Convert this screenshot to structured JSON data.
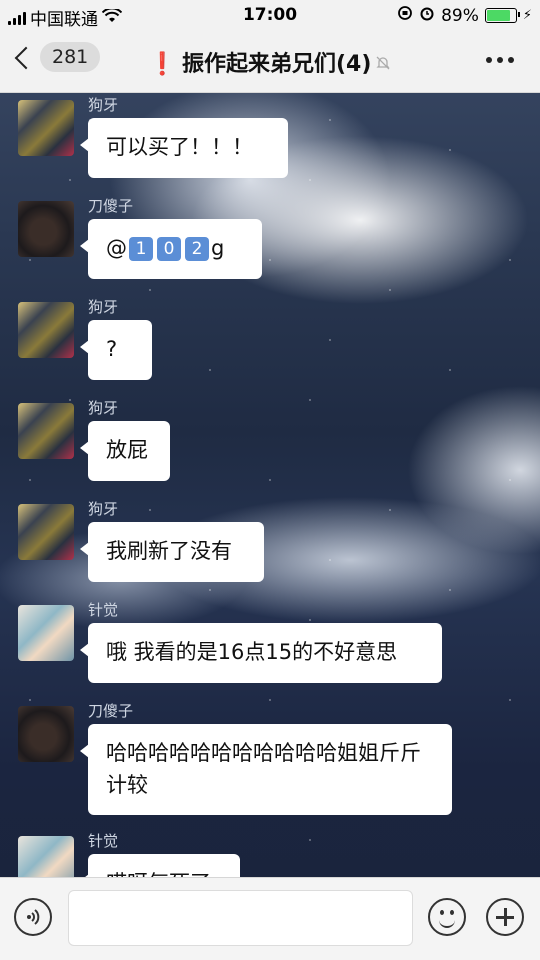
{
  "status_bar": {
    "carrier": "中国联通",
    "time": "17:00",
    "battery_percent": "89%",
    "battery_level": 0.89,
    "icons": [
      "signal-icon",
      "wifi-icon",
      "orientation-lock-icon",
      "alarm-icon",
      "battery-icon",
      "charging-icon"
    ]
  },
  "nav": {
    "back_count": "281",
    "alert_mark": "❗",
    "title": "振作起来弟兄们(4)",
    "mute_icon": "bell-slash-icon",
    "more_icon": "more-dots-icon"
  },
  "messages": [
    {
      "sender": "狗牙",
      "avatar": "dog",
      "text": "可以买了！！！"
    },
    {
      "sender": "刀傻子",
      "avatar": "dao",
      "text_prefix": "@",
      "keycaps": [
        "1",
        "0",
        "2"
      ],
      "text_suffix": "g"
    },
    {
      "sender": "狗牙",
      "avatar": "dog",
      "text": "?"
    },
    {
      "sender": "狗牙",
      "avatar": "dog",
      "text": "放屁"
    },
    {
      "sender": "狗牙",
      "avatar": "dog",
      "text": "我刷新了没有"
    },
    {
      "sender": "针觉",
      "avatar": "zhen",
      "text": "哦  我看的是16点15的不好意思"
    },
    {
      "sender": "刀傻子",
      "avatar": "dao",
      "text": "哈哈哈哈哈哈哈哈哈哈哈姐姐斤斤计较"
    },
    {
      "sender": "针觉",
      "avatar": "zhen",
      "text": "哎呀气死了"
    }
  ],
  "input_bar": {
    "placeholder": "",
    "icons": [
      "voice-icon",
      "emoji-icon",
      "plus-icon"
    ]
  },
  "colors": {
    "bar_bg": "#f2f2f2",
    "bubble_bg": "#ffffff",
    "sender_text": "#cfd6e2",
    "battery_green": "#4cd964",
    "alert_red": "#e02020"
  }
}
